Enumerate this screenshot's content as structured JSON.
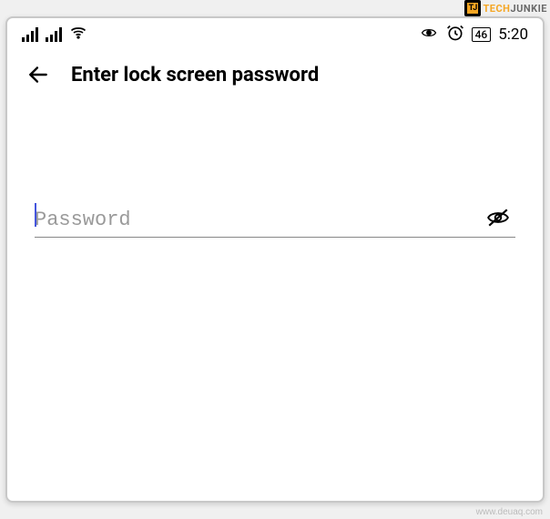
{
  "watermark": {
    "top_brand_part1": "TECH",
    "top_brand_part2": "JUNKIE",
    "top_logo_text": "TJ",
    "bottom_text": "www.deuaq.com"
  },
  "status_bar": {
    "battery_level": "46",
    "time": "5:20"
  },
  "header": {
    "title": "Enter lock screen password"
  },
  "form": {
    "password_placeholder": "Password",
    "password_value": ""
  }
}
